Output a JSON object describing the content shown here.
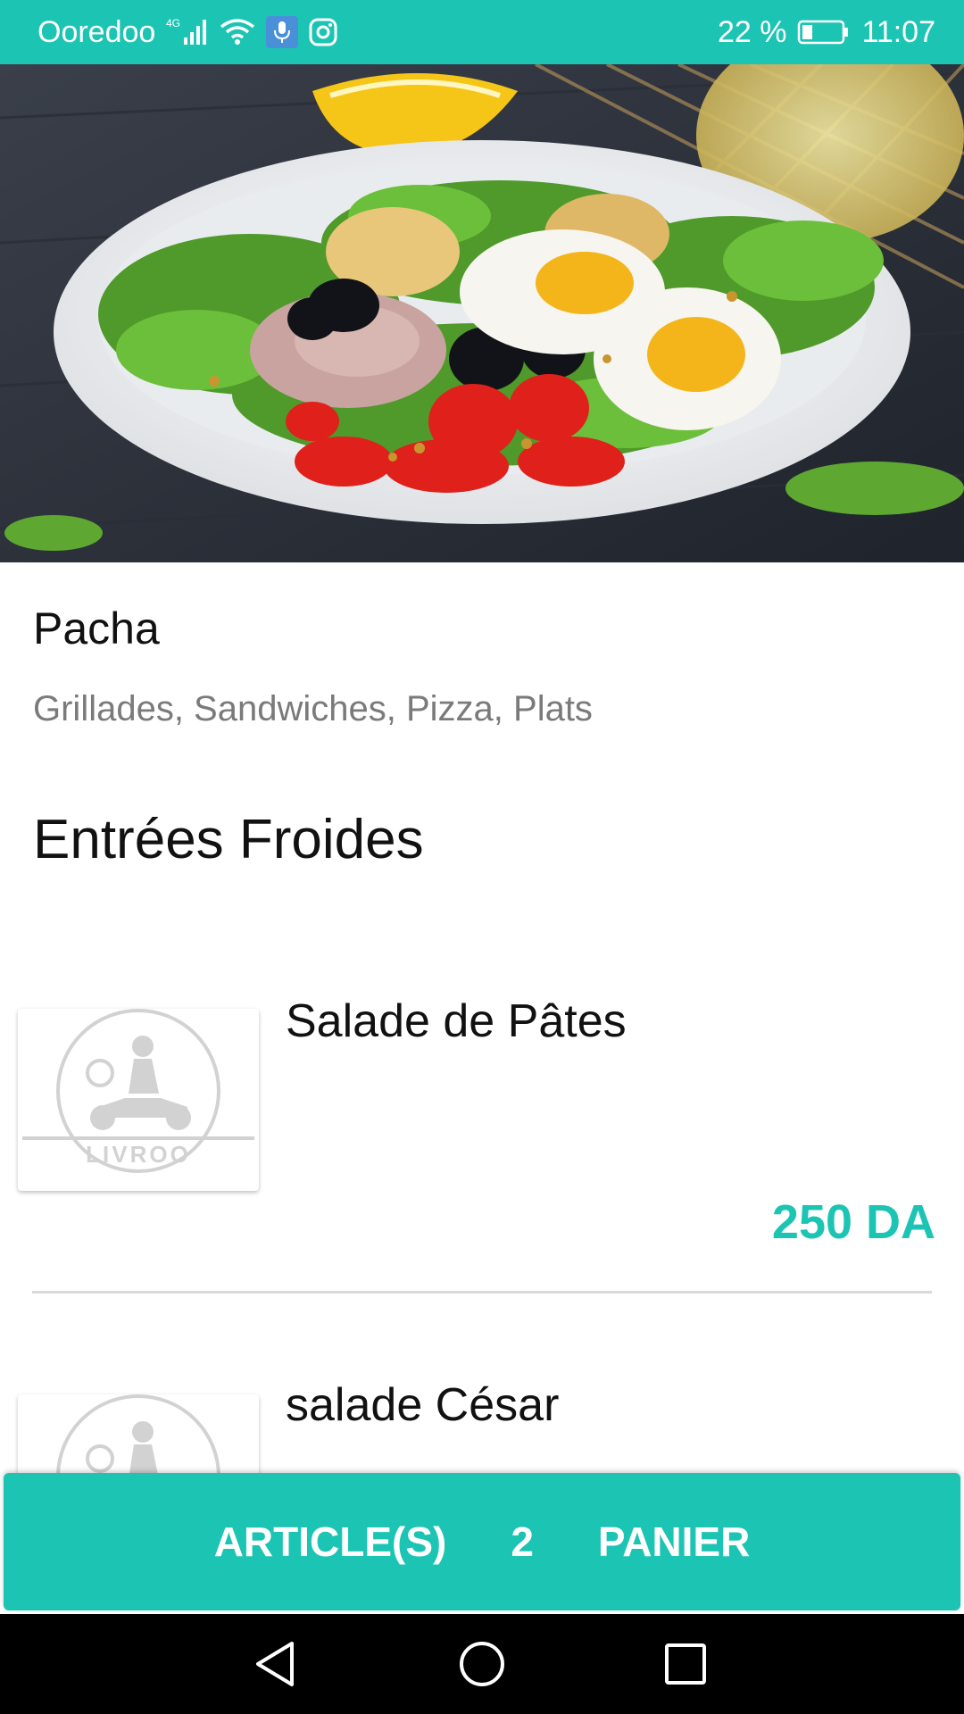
{
  "status_bar": {
    "carrier": "Ooredoo",
    "network": "4G",
    "battery": "22 %",
    "time": "11:07",
    "icons": [
      "signal-icon",
      "wifi-icon",
      "mic-icon",
      "instagram-icon",
      "battery-icon"
    ]
  },
  "hero": {
    "image": "salad-photo"
  },
  "restaurant": {
    "name": "Pacha",
    "cuisines": "Grillades, Sandwiches, Pizza, Plats"
  },
  "section": {
    "title": "Entrées Froides"
  },
  "menu_items": [
    {
      "name": "Salade de Pâtes",
      "price": "250 DA",
      "thumb_logo": "LIVROO"
    },
    {
      "name": "salade César",
      "price": "",
      "thumb_logo": "LIVROO"
    }
  ],
  "cart": {
    "articles_label": "ARTICLE(S)",
    "count": "2",
    "cart_label": "PANIER"
  },
  "nav": {
    "icons": [
      "back-icon",
      "home-icon",
      "recents-icon"
    ]
  },
  "colors": {
    "accent": "#1cc4b4",
    "text_primary": "#111111",
    "text_secondary": "#7a7a7a"
  }
}
